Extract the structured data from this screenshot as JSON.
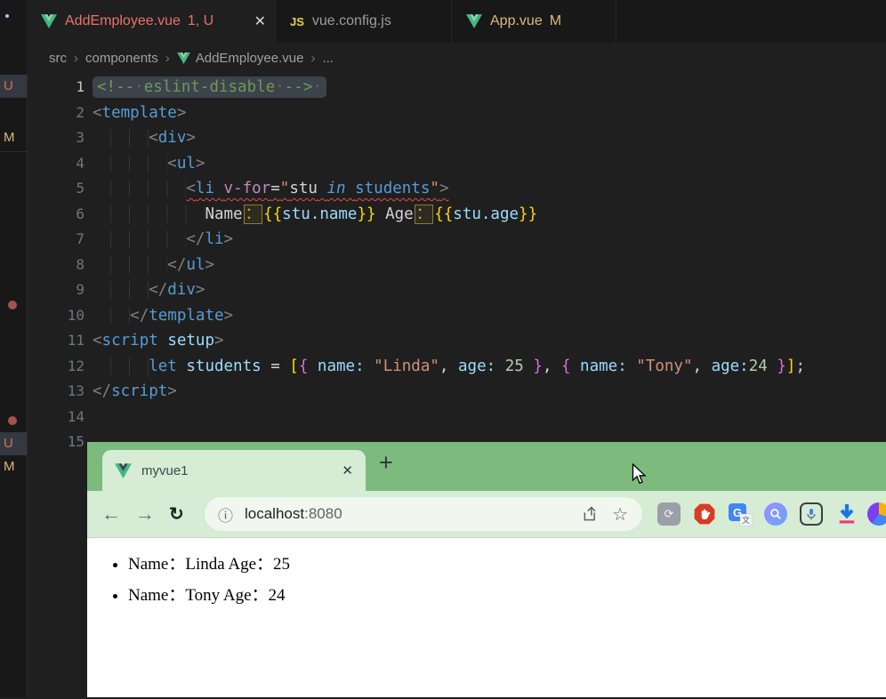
{
  "theme": {
    "editor_bg": "#1f1f1f",
    "tabbar_bg": "#181818",
    "error_tab_color": "#e8736a",
    "modified_color": "#dcb97f",
    "chrome_frame_green": "#7cba7e",
    "chrome_toolbar_green": "#d6ecd5",
    "page_bg": "#ffffff"
  },
  "glyphs": {
    "close": "✕",
    "chevron": "›",
    "ellipsis": "...",
    "back_arrow": "←",
    "forward_arrow": "→",
    "reload": "↻",
    "info": "ⓘ",
    "star": "☆",
    "new_tab": "+",
    "sync": "⟳",
    "translate_g": "G",
    "translate_sub": "文"
  },
  "vscode": {
    "explorer_strip": {
      "badges": [
        {
          "label": "U"
        },
        {
          "label": "M"
        },
        {
          "label": "U"
        },
        {
          "label": "M"
        }
      ]
    },
    "tabs": [
      {
        "label": "AddEmployee.vue",
        "badge": "1, U",
        "icon": "vue",
        "active": true
      },
      {
        "label": "vue.config.js",
        "badge": "",
        "icon": "js",
        "icon_text": "JS",
        "active": false
      },
      {
        "label": "App.vue",
        "badge": "M",
        "icon": "vue",
        "active": false
      }
    ],
    "breadcrumb": {
      "items": [
        "src",
        "components",
        "AddEmployee.vue"
      ],
      "ellipsis": "..."
    },
    "code": {
      "lines": [
        {
          "n": 1,
          "active": true,
          "wrap": "sel",
          "seg": [
            {
              "t": "<!--",
              "c": "cm"
            },
            {
              "t": "·",
              "c": "ws"
            },
            {
              "t": "eslint-disable",
              "c": "cm"
            },
            {
              "t": "·",
              "c": "ws"
            },
            {
              "t": "-->",
              "c": "cm"
            },
            {
              "t": "·",
              "c": "ws"
            }
          ]
        },
        {
          "n": 2,
          "seg": [
            {
              "t": "<",
              "c": "pn"
            },
            {
              "t": "template",
              "c": "tag"
            },
            {
              "t": ">",
              "c": "pn"
            }
          ]
        },
        {
          "n": 3,
          "ind": 6,
          "seg": [
            {
              "t": "<",
              "c": "pn"
            },
            {
              "t": "div",
              "c": "tag"
            },
            {
              "t": ">",
              "c": "pn"
            }
          ]
        },
        {
          "n": 4,
          "ind": 8,
          "seg": [
            {
              "t": "<",
              "c": "pn"
            },
            {
              "t": "ul",
              "c": "tag"
            },
            {
              "t": ">",
              "c": "pn"
            }
          ]
        },
        {
          "n": 5,
          "ind": 10,
          "wrap": "sq",
          "seg": [
            {
              "t": "<",
              "c": "pn"
            },
            {
              "t": "li",
              "c": "tag"
            },
            {
              "t": " ",
              "c": "txt"
            },
            {
              "t": "v-for",
              "c": "attr"
            },
            {
              "t": "=",
              "c": "op"
            },
            {
              "t": "\"",
              "c": "str"
            },
            {
              "t": "stu",
              "c": "txt"
            },
            {
              "t": " ",
              "c": "txt"
            },
            {
              "t": "in",
              "c": "kwi"
            },
            {
              "t": " ",
              "c": "txt"
            },
            {
              "t": "students",
              "c": "kw"
            },
            {
              "t": "\"",
              "c": "str"
            },
            {
              "t": ">",
              "c": "pn"
            }
          ]
        },
        {
          "n": 6,
          "ind": 12,
          "seg": [
            {
              "t": "Name",
              "c": "txt"
            },
            {
              "t": "：",
              "c": "uni"
            },
            {
              "t": "{{",
              "c": "br1"
            },
            {
              "t": "stu.name",
              "c": "var"
            },
            {
              "t": "}}",
              "c": "br1"
            },
            {
              "t": " Age",
              "c": "txt"
            },
            {
              "t": "：",
              "c": "uni"
            },
            {
              "t": "{{",
              "c": "br1"
            },
            {
              "t": "stu.age",
              "c": "var"
            },
            {
              "t": "}}",
              "c": "br1"
            }
          ]
        },
        {
          "n": 7,
          "ind": 10,
          "seg": [
            {
              "t": "</",
              "c": "pn"
            },
            {
              "t": "li",
              "c": "tag"
            },
            {
              "t": ">",
              "c": "pn"
            }
          ]
        },
        {
          "n": 8,
          "ind": 8,
          "seg": [
            {
              "t": "</",
              "c": "pn"
            },
            {
              "t": "ul",
              "c": "tag"
            },
            {
              "t": ">",
              "c": "pn"
            }
          ]
        },
        {
          "n": 9,
          "ind": 6,
          "seg": [
            {
              "t": "</",
              "c": "pn"
            },
            {
              "t": "div",
              "c": "tag"
            },
            {
              "t": ">",
              "c": "pn"
            }
          ]
        },
        {
          "n": 10,
          "ind": 4,
          "seg": [
            {
              "t": "</",
              "c": "pn"
            },
            {
              "t": "template",
              "c": "tag"
            },
            {
              "t": ">",
              "c": "pn"
            }
          ]
        },
        {
          "n": 11,
          "seg": [
            {
              "t": "<",
              "c": "pn"
            },
            {
              "t": "script",
              "c": "tag"
            },
            {
              "t": " ",
              "c": "txt"
            },
            {
              "t": "setup",
              "c": "var"
            },
            {
              "t": ">",
              "c": "pn"
            }
          ]
        },
        {
          "n": 12,
          "ind": 6,
          "seg": [
            {
              "t": "let",
              "c": "kw"
            },
            {
              "t": " ",
              "c": "txt"
            },
            {
              "t": "students",
              "c": "var"
            },
            {
              "t": " = ",
              "c": "op"
            },
            {
              "t": "[",
              "c": "br1"
            },
            {
              "t": "{",
              "c": "br2"
            },
            {
              "t": " ",
              "c": "txt"
            },
            {
              "t": "name:",
              "c": "var"
            },
            {
              "t": " ",
              "c": "txt"
            },
            {
              "t": "\"Linda\"",
              "c": "str"
            },
            {
              "t": ", ",
              "c": "op"
            },
            {
              "t": "age:",
              "c": "var"
            },
            {
              "t": " ",
              "c": "txt"
            },
            {
              "t": "25",
              "c": "num"
            },
            {
              "t": " ",
              "c": "txt"
            },
            {
              "t": "}",
              "c": "br2"
            },
            {
              "t": ", ",
              "c": "op"
            },
            {
              "t": "{",
              "c": "br2"
            },
            {
              "t": " ",
              "c": "txt"
            },
            {
              "t": "name:",
              "c": "var"
            },
            {
              "t": " ",
              "c": "txt"
            },
            {
              "t": "\"Tony\"",
              "c": "str"
            },
            {
              "t": ", ",
              "c": "op"
            },
            {
              "t": "age:",
              "c": "var"
            },
            {
              "t": "24",
              "c": "num"
            },
            {
              "t": " ",
              "c": "txt"
            },
            {
              "t": "}",
              "c": "br2"
            },
            {
              "t": "]",
              "c": "br1"
            },
            {
              "t": ";",
              "c": "op"
            }
          ]
        },
        {
          "n": 13,
          "seg": [
            {
              "t": "</",
              "c": "pn"
            },
            {
              "t": "script",
              "c": "tag"
            },
            {
              "t": ">",
              "c": "pn"
            }
          ]
        },
        {
          "n": 14,
          "seg": []
        },
        {
          "n": 15,
          "seg": []
        }
      ]
    }
  },
  "browser": {
    "tab_title": "myvue1",
    "url": {
      "host": "localhost",
      "port": ":8080"
    },
    "extension_icons": [
      "sync-extension-icon",
      "adblock-hand-icon",
      "google-translate-icon",
      "lens-search-icon",
      "voice-mic-icon",
      "download-icon",
      "partial-extension-icon"
    ],
    "page": {
      "items": [
        "Name：Linda Age：25",
        "Name：Tony Age：24"
      ]
    }
  }
}
